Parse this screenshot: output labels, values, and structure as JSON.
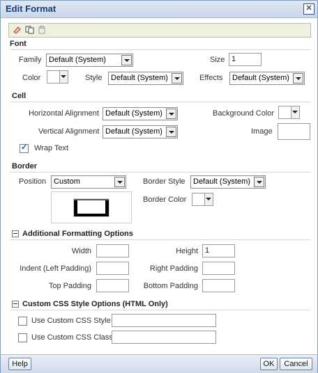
{
  "dialog": {
    "title": "Edit Format"
  },
  "toolbar": {
    "icons": [
      "clear-icon",
      "copy-icon",
      "paste-icon"
    ]
  },
  "font": {
    "section": "Font",
    "family_label": "Family",
    "family_value": "Default (System)",
    "size_label": "Size",
    "size_value": "1",
    "color_label": "Color",
    "style_label": "Style",
    "style_value": "Default (System)",
    "effects_label": "Effects",
    "effects_value": "Default (System)"
  },
  "cell": {
    "section": "Cell",
    "halign_label": "Horizontal Alignment",
    "halign_value": "Default (System)",
    "bgcolor_label": "Background Color",
    "valign_label": "Vertical Alignment",
    "valign_value": "Default (System)",
    "image_label": "Image",
    "wrap_label": "Wrap Text",
    "wrap_checked": true
  },
  "border": {
    "section": "Border",
    "position_label": "Position",
    "position_value": "Custom",
    "style_label": "Border Style",
    "style_value": "Default (System)",
    "color_label": "Border Color"
  },
  "additional": {
    "section": "Additional Formatting Options",
    "width_label": "Width",
    "width_value": "",
    "height_label": "Height",
    "height_value": "1",
    "indent_label": "Indent (Left Padding)",
    "indent_value": "",
    "right_label": "Right Padding",
    "right_value": "",
    "top_label": "Top Padding",
    "top_value": "",
    "bottom_label": "Bottom Padding",
    "bottom_value": ""
  },
  "css": {
    "section": "Custom CSS Style Options (HTML Only)",
    "style_label": "Use Custom CSS Style",
    "style_value": "",
    "class_label": "Use Custom CSS Class",
    "class_value": ""
  },
  "footer": {
    "help": "Help",
    "ok": "OK",
    "cancel": "Cancel"
  },
  "colors": {
    "title_text": "#1c3c6e",
    "accent": "#7f9db9"
  }
}
